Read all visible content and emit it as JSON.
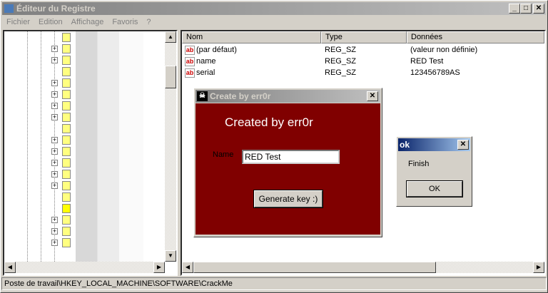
{
  "window": {
    "title": "Éditeur du Registre",
    "min": "_",
    "max": "□",
    "close": "✕"
  },
  "menu": [
    "Fichier",
    "Edition",
    "Affichage",
    "Favoris",
    "?"
  ],
  "tree": {
    "rows": [
      0,
      1,
      1,
      0,
      1,
      1,
      1,
      1,
      0,
      1,
      1,
      1,
      1,
      1,
      0,
      0,
      1,
      1,
      1
    ]
  },
  "list": {
    "headers": [
      "Nom",
      "Type",
      "Données"
    ],
    "rows": [
      {
        "name": "(par défaut)",
        "type": "REG_SZ",
        "data": "(valeur non définie)"
      },
      {
        "name": "name",
        "type": "REG_SZ",
        "data": "RED Test"
      },
      {
        "name": "serial",
        "type": "REG_SZ",
        "data": "123456789AS"
      }
    ]
  },
  "status": "Poste de travail\\HKEY_LOCAL_MACHINE\\SOFTWARE\\CrackMe",
  "keygen": {
    "title": "Create by err0r",
    "heading": "Created by err0r",
    "name_label": "Name",
    "name_value": "RED Test",
    "button": "Generate key :)",
    "close": "✕"
  },
  "msgbox": {
    "title": "ok",
    "text": "Finish",
    "ok": "OK",
    "close": "✕"
  }
}
